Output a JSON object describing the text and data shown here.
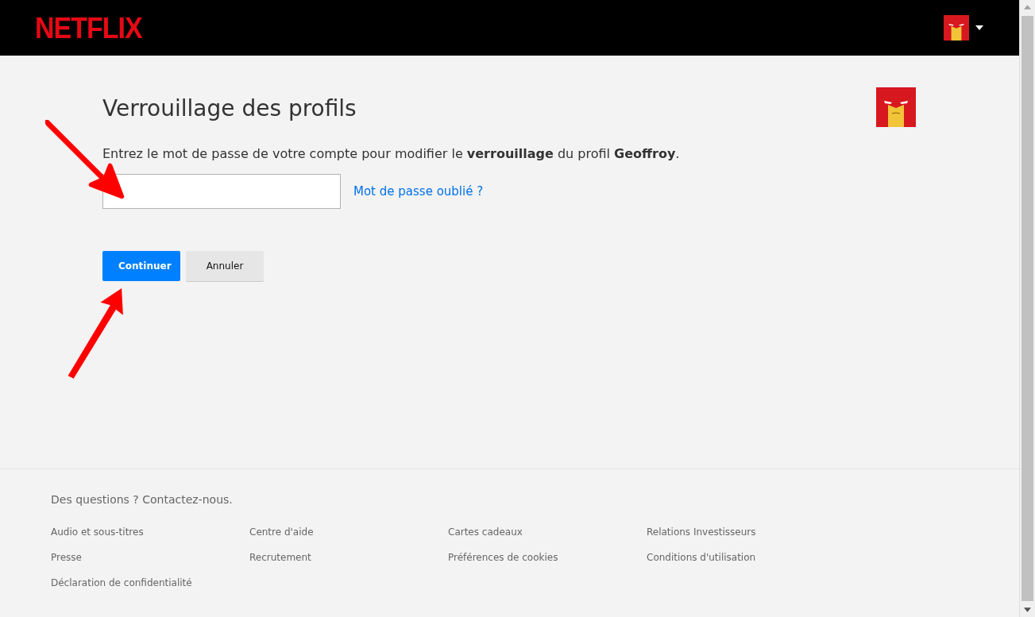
{
  "header": {
    "logo": "NETFLIX"
  },
  "lock": {
    "title": "Verrouillage des profils",
    "instructions": "Entrez le mot de passe de votre compte pour modifier le **verrouillage** du profil **Geoffroy**.",
    "forgot_link": "Mot de passe oublié ?",
    "buttons": [
      {
        "label": "Continuer",
        "kind": "primary"
      },
      {
        "label": "Annuler",
        "kind": "secondary"
      }
    ]
  },
  "footer": {
    "contact": "Des questions ? Contactez-nous.",
    "links": [
      "Audio et sous-titres",
      "Centre d'aide",
      "Cartes cadeaux",
      "Relations Investisseurs",
      "Presse",
      "Recrutement",
      "Préférences de cookies",
      "Conditions d'utilisation",
      "Déclaration de confidentialité"
    ]
  }
}
